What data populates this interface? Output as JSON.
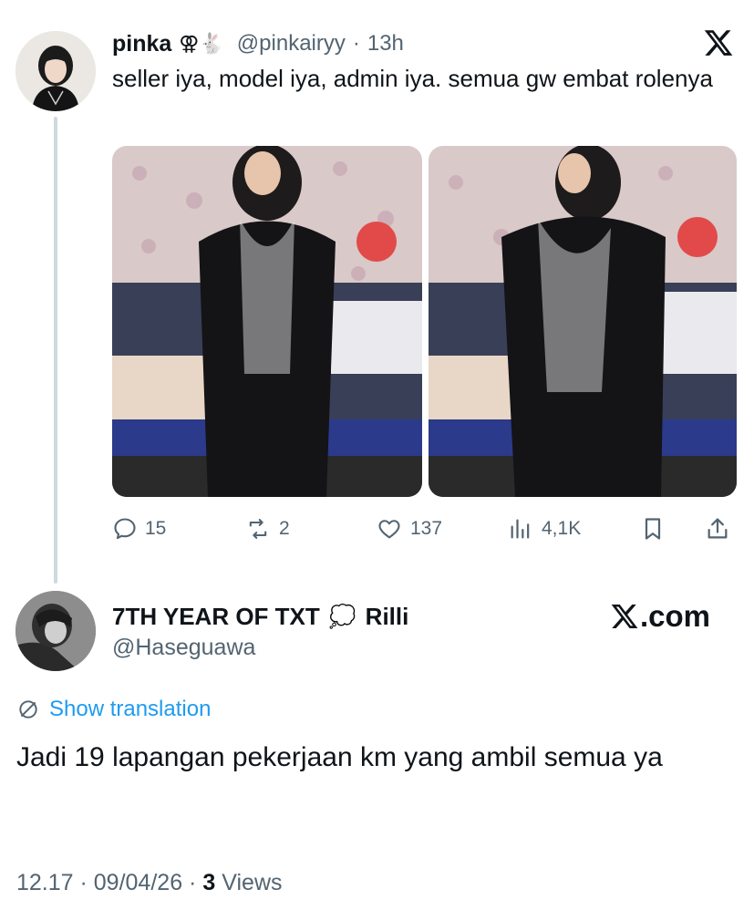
{
  "tweet": {
    "author_name": "pinka",
    "author_emoji": "⚢🐇",
    "handle": "@pinkairyy",
    "separator": "·",
    "time": "13h",
    "text": "seller iya, model iya, admin iya. semua gw embat rolenya",
    "stats": {
      "replies": "15",
      "reposts": "2",
      "likes": "137",
      "views": "4,1K"
    }
  },
  "reply": {
    "author_name": "7TH YEAR OF TXT",
    "author_emoji": "💭",
    "author_suffix": "Rilli",
    "handle": "@Haseguawa",
    "translate_label": "Show translation",
    "text": "Jadi 19 lapangan pekerjaan km yang ambil semua ya",
    "timestamp": "12.17 · 09/04/26 ·",
    "views_count": "3",
    "views_label": "Views"
  },
  "watermark": {
    "logo": "X",
    "text": ".com"
  },
  "colors": {
    "link": "#1d9bf0",
    "muted": "#536471",
    "text": "#0f1419"
  }
}
